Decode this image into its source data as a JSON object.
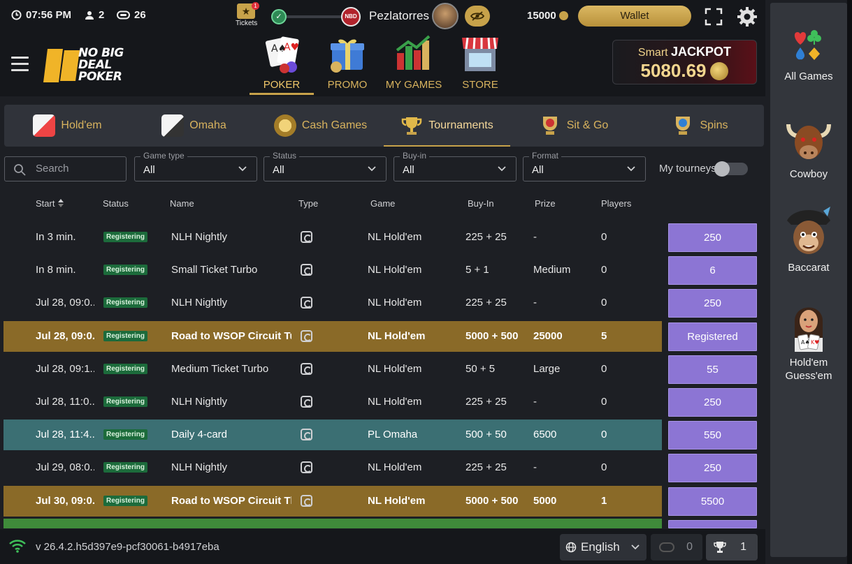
{
  "status_bar": {
    "time": "07:56 PM",
    "users_count": "2",
    "tables_count": "26",
    "tickets_label": "Tickets",
    "tickets_badge": "1",
    "level_badge": "NBD",
    "username": "Pezlatorres",
    "balance": "15000",
    "wallet_label": "Wallet"
  },
  "header": {
    "logo_text": [
      "NO BIG",
      "DEAL",
      "POKER"
    ],
    "nav": [
      {
        "label": "POKER",
        "active": true
      },
      {
        "label": "PROMO",
        "active": false
      },
      {
        "label": "MY GAMES",
        "active": false
      },
      {
        "label": "STORE",
        "active": false
      }
    ],
    "jackpot": {
      "prefix": "Smart",
      "title": "JACKPOT",
      "value": "5080.69"
    }
  },
  "categories": [
    {
      "label": "Hold'em",
      "icon": "holdem-cards-icon",
      "active": false
    },
    {
      "label": "Omaha",
      "icon": "omaha-cards-icon",
      "active": false
    },
    {
      "label": "Cash Games",
      "icon": "chip-icon",
      "active": false
    },
    {
      "label": "Tournaments",
      "icon": "trophy-icon",
      "active": true
    },
    {
      "label": "Sit & Go",
      "icon": "sit-go-trophy-icon",
      "active": false
    },
    {
      "label": "Spins",
      "icon": "spins-trophy-icon",
      "active": false
    }
  ],
  "filters": {
    "search_placeholder": "Search",
    "game_type": {
      "label": "Game type",
      "value": "All"
    },
    "status": {
      "label": "Status",
      "value": "All"
    },
    "buy_in": {
      "label": "Buy-in",
      "value": "All"
    },
    "format": {
      "label": "Format",
      "value": "All"
    },
    "my_tourneys_label": "My tourneys",
    "my_tourneys_on": false
  },
  "table": {
    "headers": {
      "start": "Start",
      "status": "Status",
      "name": "Name",
      "type": "Type",
      "game": "Game",
      "buyin": "Buy-In",
      "prize": "Prize",
      "players": "Players"
    },
    "rows": [
      {
        "start": "In 3 min.",
        "status": "Registering",
        "name": "NLH Nightly",
        "game": "NL Hold'em",
        "buyin": "225 + 25",
        "prize": "-",
        "players": "0",
        "action": "250",
        "highlight": ""
      },
      {
        "start": "In 8 min.",
        "status": "Registering",
        "name": "Small Ticket Turbo",
        "game": "NL Hold'em",
        "buyin": "5 + 1",
        "prize": "Medium",
        "players": "0",
        "action": "6",
        "highlight": ""
      },
      {
        "start": "Jul 28, 09:0...",
        "status": "Registering",
        "name": "NLH Nightly",
        "game": "NL Hold'em",
        "buyin": "225 + 25",
        "prize": "-",
        "players": "0",
        "action": "250",
        "highlight": ""
      },
      {
        "start": "Jul 28, 09:0...",
        "status": "Registering",
        "name": "Road to WSOP Circuit Tue...",
        "game": "NL Hold'em",
        "buyin": "5000 + 500",
        "prize": "25000",
        "players": "5",
        "action": "Registered",
        "highlight": "gold"
      },
      {
        "start": "Jul 28, 09:1...",
        "status": "Registering",
        "name": "Medium Ticket Turbo",
        "game": "NL Hold'em",
        "buyin": "50 + 5",
        "prize": "Large",
        "players": "0",
        "action": "55",
        "highlight": ""
      },
      {
        "start": "Jul 28, 11:0...",
        "status": "Registering",
        "name": "NLH Nightly",
        "game": "NL Hold'em",
        "buyin": "225 + 25",
        "prize": "-",
        "players": "0",
        "action": "250",
        "highlight": ""
      },
      {
        "start": "Jul 28, 11:4...",
        "status": "Registering",
        "name": "Daily 4-card",
        "game": "PL Omaha",
        "buyin": "500 + 50",
        "prize": "6500",
        "players": "0",
        "action": "550",
        "highlight": "teal"
      },
      {
        "start": "Jul 29, 08:0...",
        "status": "Registering",
        "name": "NLH Nightly",
        "game": "NL Hold'em",
        "buyin": "225 + 25",
        "prize": "-",
        "players": "0",
        "action": "250",
        "highlight": ""
      },
      {
        "start": "Jul 30, 09:0...",
        "status": "Registering",
        "name": "Road to WSOP Circuit Thu...",
        "game": "NL Hold'em",
        "buyin": "5000 + 500",
        "prize": "5000",
        "players": "1",
        "action": "5500",
        "highlight": "gold"
      }
    ]
  },
  "footer": {
    "version": "v 26.4.2.h5d397e9-pcf30061-b4917eba",
    "language": "English",
    "tables_open": "0",
    "tourneys_registered": "1"
  },
  "sidebar": {
    "items": [
      {
        "label": "All Games",
        "icon": "card-suits-icon"
      },
      {
        "label": "Cowboy",
        "icon": "bull-icon"
      },
      {
        "label": "Baccarat",
        "icon": "pirate-monkey-icon"
      },
      {
        "label": "Hold'em Guess'em",
        "icon": "dealer-woman-icon"
      }
    ]
  },
  "colors": {
    "accent_gold": "#c7a24a",
    "action_purple": "#8c75d4",
    "row_gold": "#8a6a28",
    "row_teal": "#3b6f73",
    "status_green": "#1c6b3b"
  }
}
